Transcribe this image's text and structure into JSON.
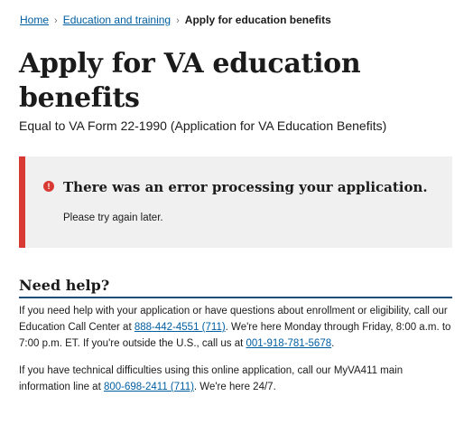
{
  "breadcrumb": {
    "items": [
      "Home",
      "Education and training"
    ],
    "current": "Apply for education benefits",
    "separator": "›"
  },
  "page": {
    "title": "Apply for VA education benefits",
    "subtitle": "Equal to VA Form 22-1990 (Application for VA Education Benefits)"
  },
  "alert": {
    "icon": "error-icon",
    "icon_glyph": "!",
    "heading": "There was an error processing your application.",
    "body": "Please try again later.",
    "accent_color": "#d83933"
  },
  "help": {
    "heading": "Need help?",
    "p1_a": "If you need help with your application or have questions about enrollment or eligibility, call our Education Call Center at ",
    "p1_phone1": "888-442-4551 (711)",
    "p1_b": ". We're here Monday through Friday, 8:00 a.m. to 7:00 p.m. ET. If you're outside the U.S., call us at ",
    "p1_phone2": "001-918-781-5678",
    "p1_c": ".",
    "p2_a": "If you have technical difficulties using this online application, call our MyVA411 main information line at ",
    "p2_phone": "800-698-2411 (711)",
    "p2_b": ". We're here 24/7."
  },
  "colors": {
    "link": "#005ea2",
    "error": "#d83933",
    "heading_rule": "#1f4e79"
  }
}
